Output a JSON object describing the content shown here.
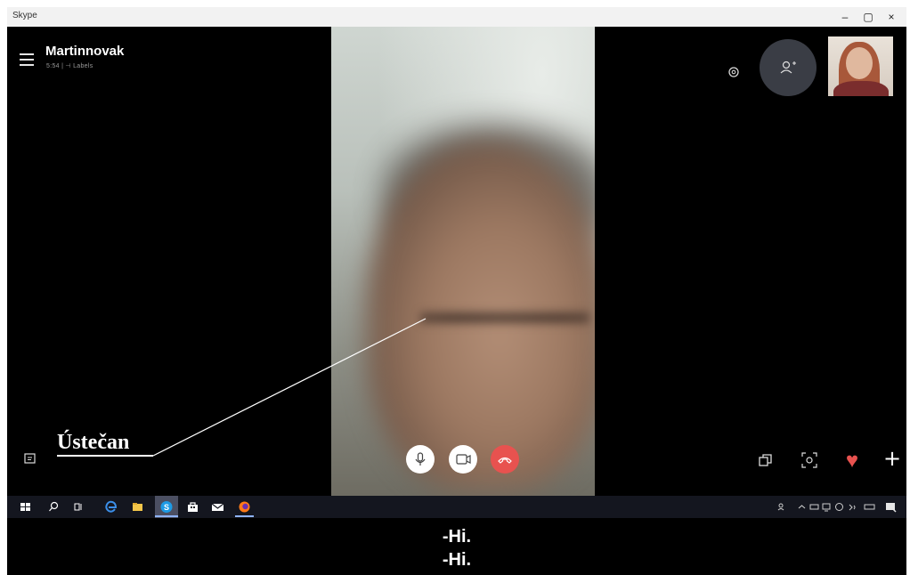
{
  "window": {
    "title": "Skype",
    "minimize_glyph": "–",
    "maximize_glyph": "▢",
    "close_glyph": "×"
  },
  "call": {
    "contact_name": "Martinnovak",
    "call_info": "5:54 | ⊣ Labels"
  },
  "annotation": {
    "label": "Ústečan"
  },
  "controls": {
    "top_right": [
      "settings-icon",
      "add-people-icon",
      "self-view"
    ],
    "bottom_left": [
      "chat-icon"
    ],
    "bottom_center": [
      "microphone-icon",
      "video-camera-icon",
      "hang-up-icon"
    ],
    "bottom_right": [
      "switch-camera-icon",
      "snapshot-icon",
      "heart-icon",
      "plus-icon"
    ],
    "hangup_color": "#e8524f",
    "heart_color": "#e8524f",
    "heart_glyph": "♥",
    "plus_glyph": "+"
  },
  "taskbar": {
    "icons": [
      "windows-start-icon",
      "search-icon",
      "task-view-icon",
      "edge-icon",
      "file-explorer-icon",
      "skype-icon",
      "store-icon",
      "mail-icon",
      "firefox-icon"
    ],
    "active_app": "skype-icon",
    "tray_icons": [
      "people-icon",
      "chevron-up-icon",
      "network-icon",
      "wifi-icon",
      "volume-icon",
      "keyboard-icon",
      "notification-icon"
    ]
  },
  "subtitles": {
    "line1": "-Hi.",
    "line2": "-Hi."
  }
}
